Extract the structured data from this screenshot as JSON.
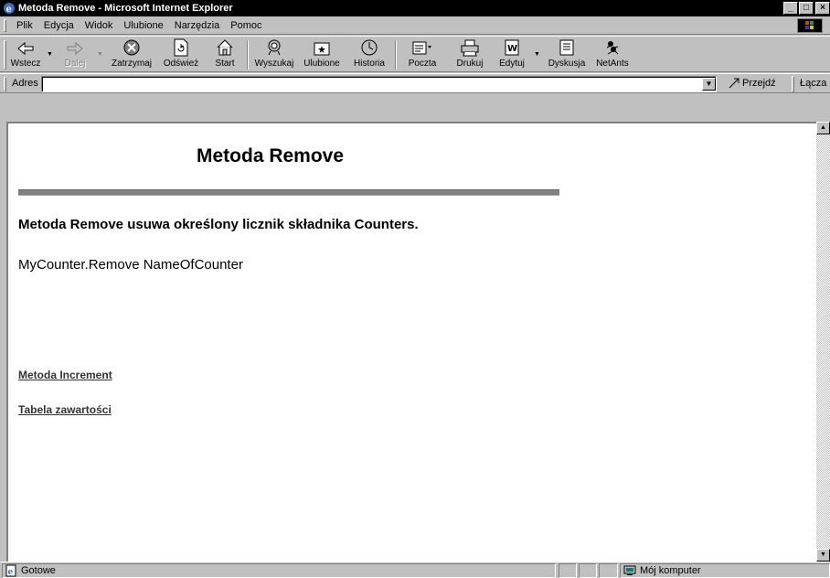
{
  "window": {
    "title": "Metoda Remove - Microsoft Internet Explorer",
    "controls": [
      "_",
      "□",
      "×"
    ]
  },
  "menu": [
    {
      "label": "Plik"
    },
    {
      "label": "Edycja"
    },
    {
      "label": "Widok"
    },
    {
      "label": "Ulubione"
    },
    {
      "label": "Narzędzia"
    },
    {
      "label": "Pomoc"
    }
  ],
  "toolbar": {
    "back": "Wstecz",
    "forward": "Dalej",
    "stop": "Zatrzymaj",
    "refresh": "Odśwież",
    "home": "Start",
    "search": "Wyszukaj",
    "favorites": "Ulubione",
    "history": "Historia",
    "mail": "Poczta",
    "print": "Drukuj",
    "edit": "Edytuj",
    "discuss": "Dyskusja",
    "netants": "NetAnts"
  },
  "address": {
    "label": "Adres",
    "value": "",
    "go": "Przejdź",
    "links": "Łącza"
  },
  "page": {
    "title": "Metoda Remove",
    "description": "Metoda Remove usuwa określony licznik składnika Counters.",
    "syntax": "MyCounter.Remove NameOfCounter",
    "link1": "Metoda Increment",
    "link2": "Tabela zawartości"
  },
  "status": {
    "text": "Gotowe",
    "zone": "Mój komputer"
  }
}
